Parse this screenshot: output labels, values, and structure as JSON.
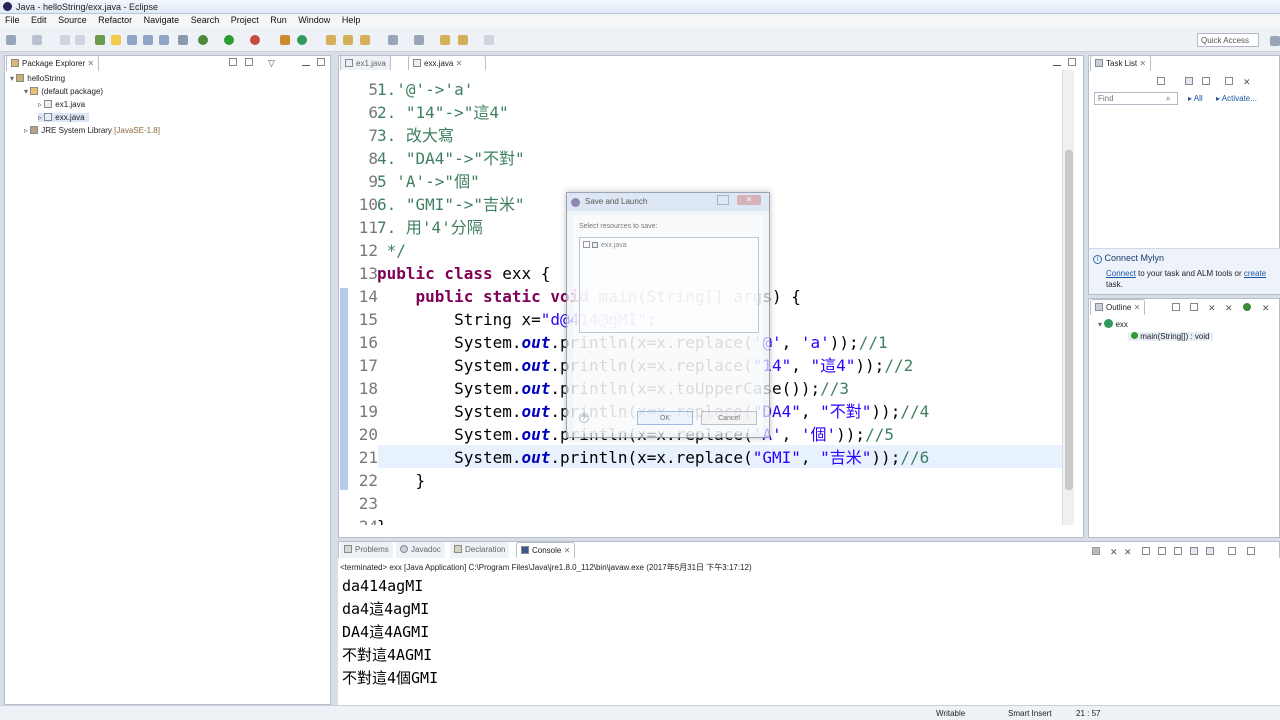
{
  "window": {
    "title": "Java - helloString/exx.java - Eclipse"
  },
  "menu": [
    "File",
    "Edit",
    "Source",
    "Refactor",
    "Navigate",
    "Search",
    "Project",
    "Run",
    "Window",
    "Help"
  ],
  "quick_access": "Quick Access",
  "package_explorer": {
    "tab": "Package Explorer",
    "tree": [
      {
        "label": "helloString",
        "depth": 0
      },
      {
        "label": "(default package)",
        "depth": 1
      },
      {
        "label": "ex1.java",
        "depth": 2
      },
      {
        "label": "exx.java",
        "depth": 2
      },
      {
        "label": "JRE System Library",
        "extra": "[JavaSE-1.8]",
        "depth": 0
      }
    ]
  },
  "editor": {
    "tabs": [
      "ex1.java",
      "exx.java"
    ],
    "active_tab": "exx.java",
    "lines": [
      {
        "n": "5",
        "html": "<span class=\"cm\">1.'@'-&gt;'a'</span>"
      },
      {
        "n": "6",
        "html": "<span class=\"cm\">2. \"14\"-&gt;\"這4\"</span>"
      },
      {
        "n": "7",
        "html": "<span class=\"cm\">3. 改大寫</span>"
      },
      {
        "n": "8",
        "html": "<span class=\"cm\">4. \"DA4\"-&gt;\"不對\"</span>"
      },
      {
        "n": "9",
        "html": "<span class=\"cm\">5 'A'-&gt;\"個\"</span>"
      },
      {
        "n": "10",
        "html": "<span class=\"cm\">6. \"GMI\"-&gt;\"吉米\"</span>"
      },
      {
        "n": "11",
        "html": "<span class=\"cm\">7. 用'4'分隔</span>"
      },
      {
        "n": "12",
        "html": "<span class=\"cm\"> */</span>"
      },
      {
        "n": "13",
        "html": "<span class=\"kw\">public class</span> exx {"
      },
      {
        "n": "14",
        "html": "    <span class=\"kw\">public static void</span> main(String[] args) {"
      },
      {
        "n": "15",
        "html": "        String x=<span class=\"st\">\"d@414@gMI\"</span>;"
      },
      {
        "n": "16",
        "html": "        System.<span class=\"fi\">out</span>.println(x=x.replace(<span class=\"st\">'@'</span>, <span class=\"st\">'a'</span>));<span class=\"cm\">//1</span>"
      },
      {
        "n": "17",
        "html": "        System.<span class=\"fi\">out</span>.println(x=x.replace(<span class=\"st\">\"14\"</span>, <span class=\"st\">\"這4\"</span>));<span class=\"cm\">//2</span>"
      },
      {
        "n": "18",
        "html": "        System.<span class=\"fi\">out</span>.println(x=x.toUpperCase());<span class=\"cm\">//3</span>"
      },
      {
        "n": "19",
        "html": "        System.<span class=\"fi\">out</span>.println(x=x.replace(<span class=\"st\">\"DA4\"</span>, <span class=\"st\">\"不對\"</span>));<span class=\"cm\">//4</span>"
      },
      {
        "n": "20",
        "html": "        System.<span class=\"fi\">out</span>.println(x=x.replace(<span class=\"st\">'A'</span>, <span class=\"st\">'個'</span>));<span class=\"cm\">//5</span>"
      },
      {
        "n": "21",
        "html": "        System.<span class=\"fi\">out</span>.println(x=x.replace(<span class=\"st\">\"GMI\"</span>, <span class=\"st\">\"吉米\"</span>));<span class=\"cm\">//6</span>"
      },
      {
        "n": "22",
        "html": "    }"
      },
      {
        "n": "23",
        "html": ""
      },
      {
        "n": "24",
        "html": "}"
      }
    ]
  },
  "bottom_tabs": [
    "Problems",
    "Javadoc",
    "Declaration",
    "Console"
  ],
  "console": {
    "header": "<terminated> exx [Java Application] C:\\Program Files\\Java\\jre1.8.0_112\\bin\\javaw.exe (2017年5月31日 下午3:17:12)",
    "output": [
      "da414agMI",
      "da4這4agMI",
      "DA4這4AGMI",
      "不對這4AGMI",
      "不對這4個GMI"
    ]
  },
  "task_list": {
    "tab": "Task List",
    "find_placeholder": "Find",
    "all": "All",
    "activate": "Activate..."
  },
  "mylyn": {
    "title": "Connect Mylyn",
    "link": "Connect",
    "text": " to your task and ALM tools or ",
    "link2": "create",
    "text2": "task."
  },
  "outline": {
    "tab": "Outline",
    "items": [
      "exx",
      "main(String[]) : void"
    ]
  },
  "dialog": {
    "title": "Save and Launch",
    "prompt": "Select resources to save:",
    "item": "exx.java",
    "ok": "OK",
    "cancel": "Cancel"
  },
  "status": {
    "writable": "Writable",
    "insert": "Smart Insert",
    "position": "21 : 57"
  }
}
